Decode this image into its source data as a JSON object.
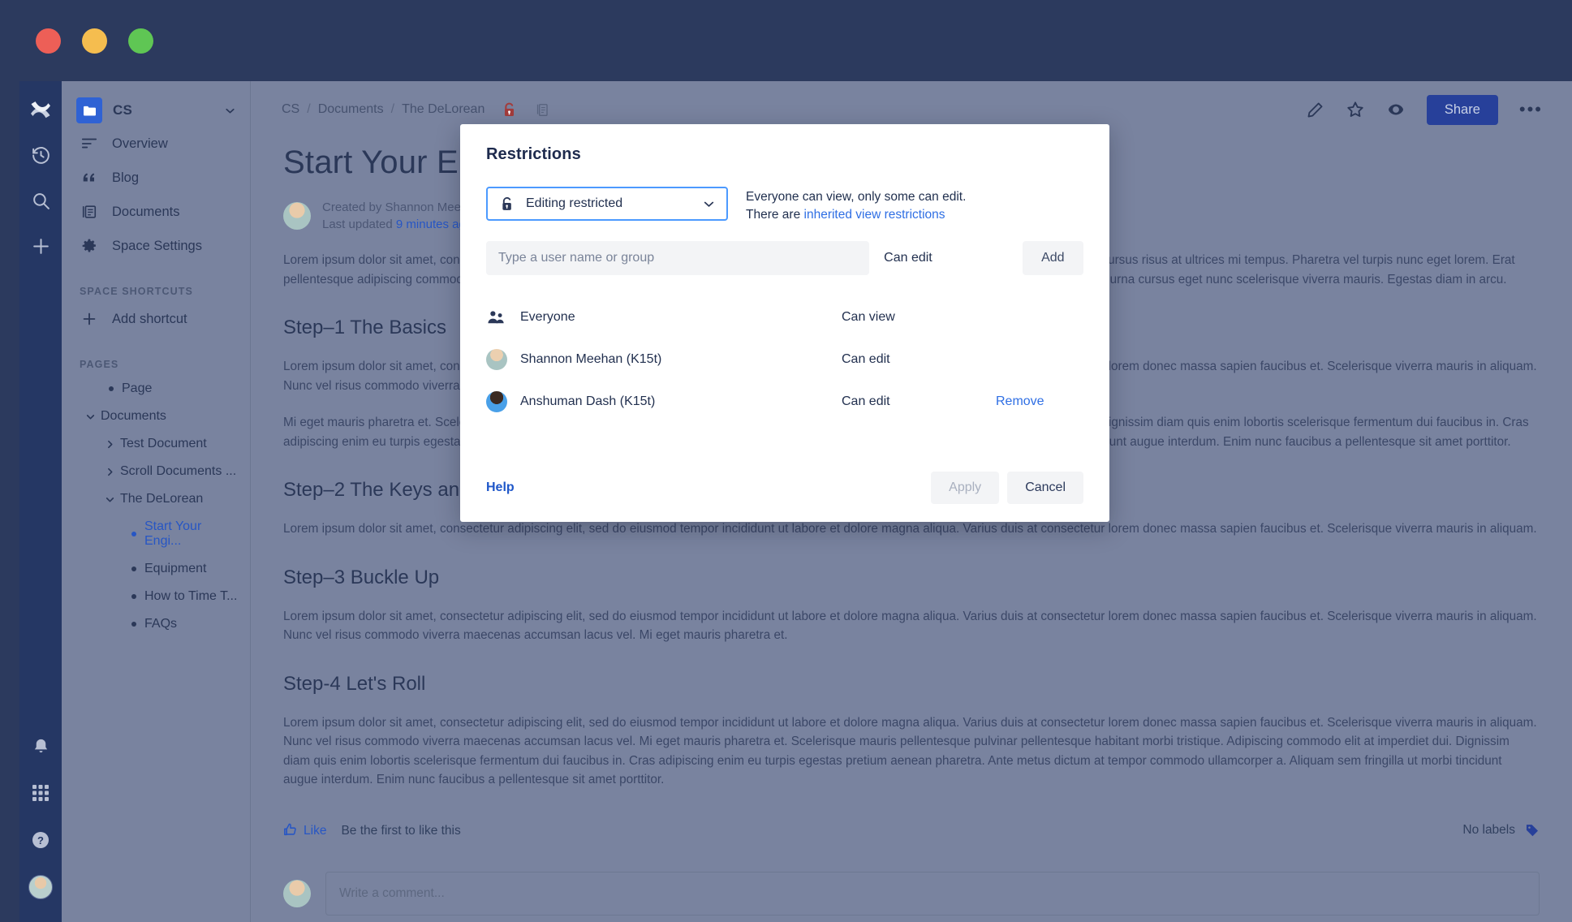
{
  "window": {
    "traffic_lights": [
      "close",
      "minimize",
      "zoom"
    ]
  },
  "rail": {
    "top_icons": [
      "confluence-logo-icon",
      "recent-history-icon",
      "search-icon",
      "create-icon"
    ],
    "bottom_icons": [
      "notifications-bell-icon",
      "app-switcher-icon",
      "help-icon",
      "profile-avatar"
    ]
  },
  "sidebar": {
    "space_name": "CS",
    "space_logo_icon": "space-folder-icon",
    "caret_icon": "chevron-down-icon",
    "nav": [
      {
        "label": "Overview",
        "icon": "overview-icon"
      },
      {
        "label": "Blog",
        "icon": "blog-quote-icon"
      },
      {
        "label": "Documents",
        "icon": "documents-icon"
      },
      {
        "label": "Space Settings",
        "icon": "gear-icon"
      }
    ],
    "shortcuts_heading": "SPACE SHORTCUTS",
    "add_shortcut_label": "Add shortcut",
    "add_shortcut_icon": "plus-icon",
    "pages_heading": "PAGES",
    "tree": [
      {
        "label": "Page",
        "level": 1,
        "twisty": "none",
        "active": false
      },
      {
        "label": "Documents",
        "level": 1,
        "twisty": "down",
        "active": false
      },
      {
        "label": "Test Document",
        "level": 2,
        "twisty": "right",
        "active": false
      },
      {
        "label": "Scroll Documents ...",
        "level": 2,
        "twisty": "right",
        "active": false
      },
      {
        "label": "The DeLorean",
        "level": 2,
        "twisty": "down",
        "active": false
      },
      {
        "label": "Start Your Engi...",
        "level": 3,
        "twisty": "none",
        "active": true
      },
      {
        "label": "Equipment",
        "level": 3,
        "twisty": "none",
        "active": false
      },
      {
        "label": "How to Time T...",
        "level": 3,
        "twisty": "none",
        "active": false
      },
      {
        "label": "FAQs",
        "level": 3,
        "twisty": "none",
        "active": false
      }
    ]
  },
  "topbar": {
    "breadcrumbs": [
      "CS",
      "Documents",
      "The DeLorean"
    ],
    "separator": "/",
    "lock_icon": "restricted-lock-icon",
    "copy_icon": "page-copy-icon",
    "actions": [
      {
        "icon": "edit-pencil-icon"
      },
      {
        "icon": "watch-star-icon"
      },
      {
        "icon": "watch-eye-icon"
      }
    ],
    "share_label": "Share",
    "more_label": "•••",
    "more_icon": "more-options-icon"
  },
  "page": {
    "title": "Start Your Engines",
    "created_by": "Created by Shannon Meehan (",
    "last_updated_prefix": "Last updated",
    "last_updated_value": "9 minutes ago",
    "intro": "Lorem ipsum dolor sit amet, consectetur adipiscing elit, sed do eiusmod tempor incididunt ut labore et dolore magna aliqua. Vestibulum morbi blandit cursus risus at ultrices mi tempus. Pharetra vel turpis nunc eget lorem. Erat pellentesque adipiscing commodo elit at imperdiet dui. Dignissim diam quis enim lobortis scelerisque. Quis commodo odio aenean. Sit amet venenatis urna cursus eget nunc scelerisque viverra mauris. Egestas diam in arcu.",
    "sections": [
      {
        "heading": "Step–1 The Basics",
        "paragraphs": [
          "Lorem ipsum dolor sit amet, consectetur adipiscing elit, sed do eiusmod tempor incididunt ut labore et dolore magna aliqua. Varius duis at consectetur lorem donec massa sapien faucibus et. Scelerisque viverra mauris in aliquam. Nunc vel risus commodo viverra maecenas accumsan lacus vel. Mi eget mauris pharetra et.",
          "Mi eget mauris pharetra et. Scelerisque mauris pellentesque pulvinar pellentesque habitant morbi tristique. Adipiscing commodo elit at imperdiet dui. Dignissim diam quis enim lobortis scelerisque fermentum dui faucibus in. Cras adipiscing enim eu turpis egestas pretium aenean pharetra. Ante metus dictum at tempor commodo ullamcorper a. Aliquam sem fringilla ut morbi tincidunt augue interdum. Enim nunc faucibus a pellentesque sit amet porttitor."
        ]
      },
      {
        "heading": "Step–2 The Keys and Ignition",
        "paragraphs": [
          "Lorem ipsum dolor sit amet, consectetur adipiscing elit, sed do eiusmod tempor incididunt ut labore et dolore magna aliqua. Varius duis at consectetur lorem donec massa sapien faucibus et. Scelerisque viverra mauris in aliquam."
        ]
      },
      {
        "heading": "Step–3 Buckle Up",
        "paragraphs": [
          "Lorem ipsum dolor sit amet, consectetur adipiscing elit, sed do eiusmod tempor incididunt ut labore et dolore magna aliqua. Varius duis at consectetur lorem donec massa sapien faucibus et. Scelerisque viverra mauris in aliquam. Nunc vel risus commodo viverra maecenas accumsan lacus vel. Mi eget mauris pharetra et."
        ]
      },
      {
        "heading": "Step-4 Let's Roll",
        "paragraphs": [
          "Lorem ipsum dolor sit amet, consectetur adipiscing elit, sed do eiusmod tempor incididunt ut labore et dolore magna aliqua. Varius duis at consectetur lorem donec massa sapien faucibus et. Scelerisque viverra mauris in aliquam. Nunc vel risus commodo viverra maecenas accumsan lacus vel. Mi eget mauris pharetra et. Scelerisque mauris pellentesque pulvinar pellentesque habitant morbi tristique. Adipiscing commodo elit at imperdiet dui. Dignissim diam quis enim lobortis scelerisque fermentum dui faucibus in. Cras adipiscing enim eu turpis egestas pretium aenean pharetra. Ante metus dictum at tempor commodo ullamcorper a. Aliquam sem fringilla ut morbi tincidunt augue interdum. Enim nunc faucibus a pellentesque sit amet porttitor."
        ]
      }
    ],
    "like_label": "Like",
    "like_icon": "thumbs-up-icon",
    "like_status": "Be the first to like this",
    "labels_text": "No labels",
    "labels_icon": "tag-icon",
    "comment_placeholder": "Write a comment..."
  },
  "modal": {
    "title": "Restrictions",
    "restriction_select": {
      "value": "Editing restricted",
      "lock_icon": "unlocked-padlock-icon",
      "caret_icon": "chevron-down-icon"
    },
    "hint_line1": "Everyone can view, only some can edit.",
    "hint_line2_prefix": "There are",
    "hint_line2_link": "inherited view restrictions",
    "add_input_placeholder": "Type a user name or group",
    "add_permission_value": "Can edit",
    "add_button_label": "Add",
    "permission_rows": [
      {
        "name": "Everyone",
        "permission": "Can view",
        "action": "",
        "icon": "group-people-icon",
        "avatar": ""
      },
      {
        "name": "Shannon Meehan (K15t)",
        "permission": "Can edit",
        "action": "",
        "icon": "",
        "avatar": "shannon"
      },
      {
        "name": "Anshuman Dash (K15t)",
        "permission": "Can edit",
        "action": "Remove",
        "icon": "",
        "avatar": "anshuman"
      }
    ],
    "help_label": "Help",
    "apply_label": "Apply",
    "cancel_label": "Cancel"
  },
  "colors": {
    "brand_blue": "#27409a",
    "link_blue": "#2f6fe4",
    "focus_blue": "#4c9aff",
    "rail_navy": "#253764",
    "lock_red": "#a33c3c"
  }
}
